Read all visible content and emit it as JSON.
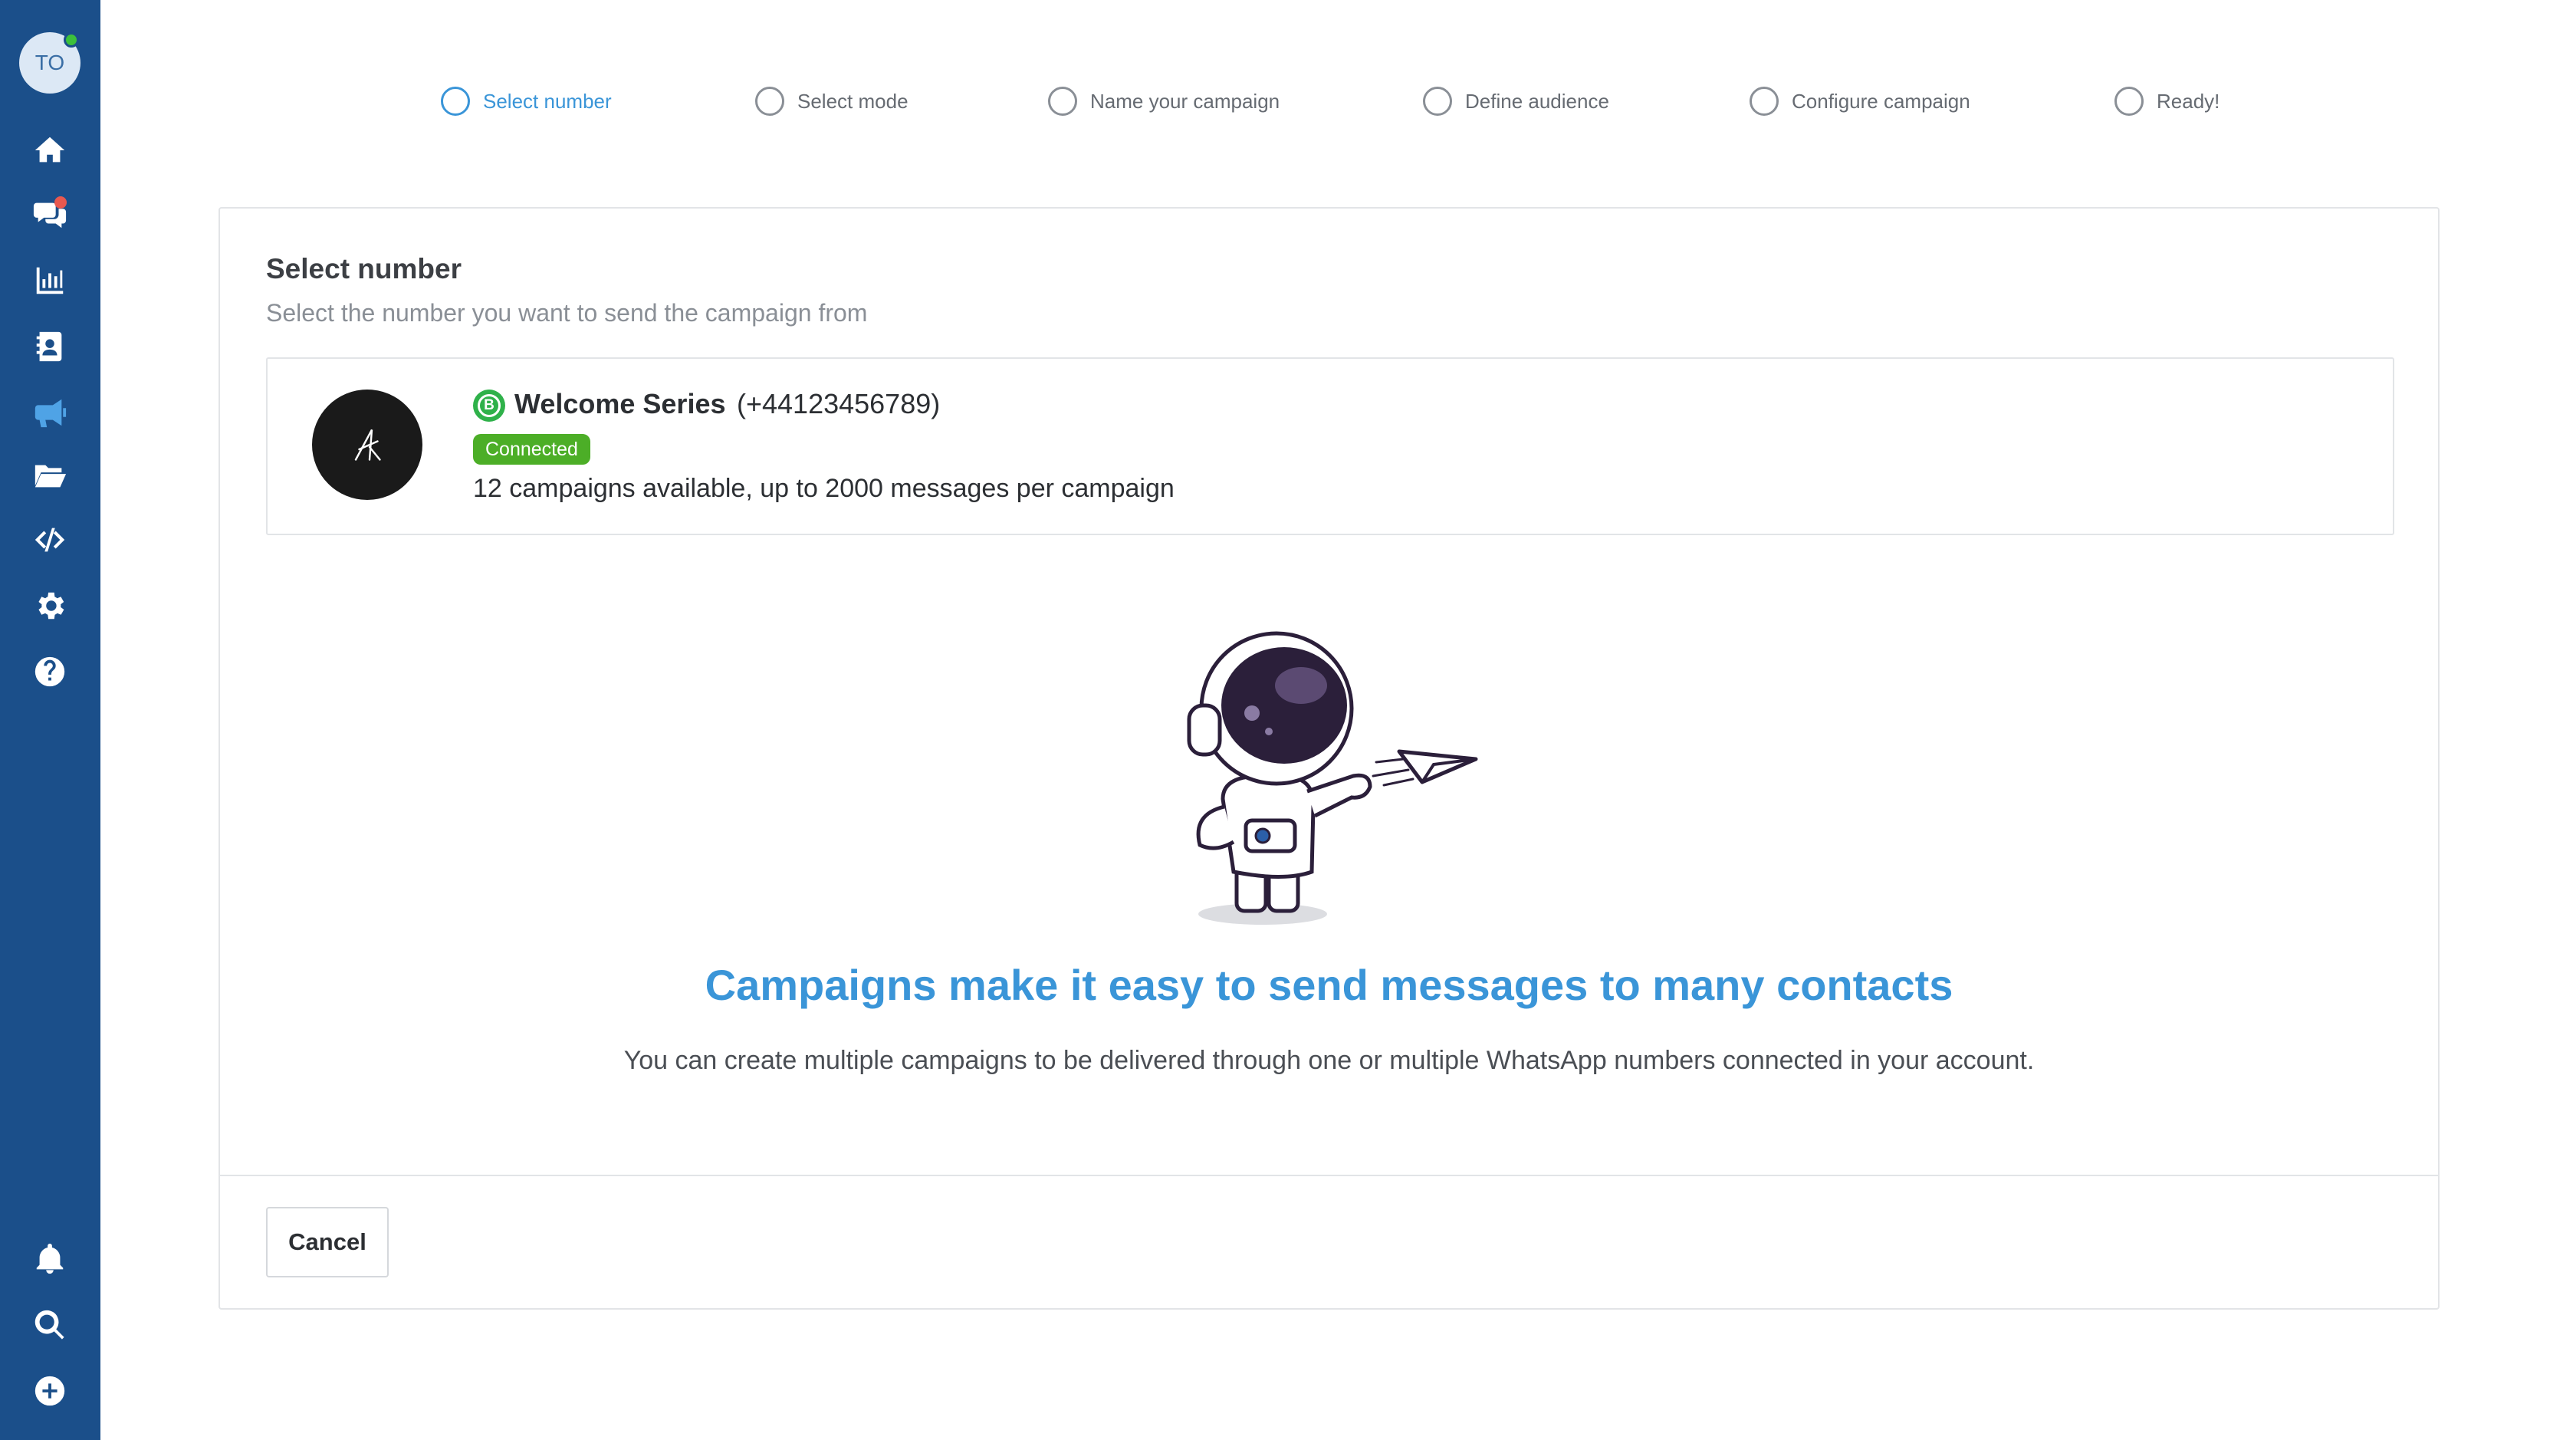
{
  "user": {
    "initials": "TO",
    "status": "online"
  },
  "sidebar": {
    "top_items": [
      {
        "icon": "home-icon"
      },
      {
        "icon": "chat-bubbles-icon",
        "badge": true
      },
      {
        "icon": "bar-chart-icon"
      },
      {
        "icon": "contacts-icon"
      },
      {
        "icon": "megaphone-icon",
        "active": true
      },
      {
        "icon": "folder-open-icon"
      },
      {
        "icon": "code-icon"
      },
      {
        "icon": "gear-icon"
      },
      {
        "icon": "help-circle-icon"
      }
    ],
    "bottom_items": [
      {
        "icon": "bell-icon"
      },
      {
        "icon": "search-icon"
      },
      {
        "icon": "plus-circle-icon"
      }
    ]
  },
  "stepper": {
    "steps": [
      {
        "label": "Select number",
        "active": true
      },
      {
        "label": "Select mode"
      },
      {
        "label": "Name your campaign"
      },
      {
        "label": "Define audience"
      },
      {
        "label": "Configure campaign"
      },
      {
        "label": "Ready!"
      }
    ]
  },
  "card": {
    "title": "Select number",
    "subtitle": "Select the number you want to send the campaign from"
  },
  "number": {
    "name": "Welcome Series",
    "phone": "(+44123456789)",
    "type_badge": "B",
    "status": "Connected",
    "description": "12 campaigns available, up to 2000 messages per campaign"
  },
  "promo": {
    "heading": "Campaigns make it easy to send messages to many contacts",
    "text": "You can create multiple campaigns to be delivered through one or multiple WhatsApp numbers connected in your account."
  },
  "actions": {
    "cancel_label": "Cancel"
  },
  "colors": {
    "sidebar": "#1b4f8a",
    "accent": "#3a95d8",
    "connected": "#4cae27",
    "whatsapp": "#2fb14a",
    "notification": "#e8584f"
  }
}
